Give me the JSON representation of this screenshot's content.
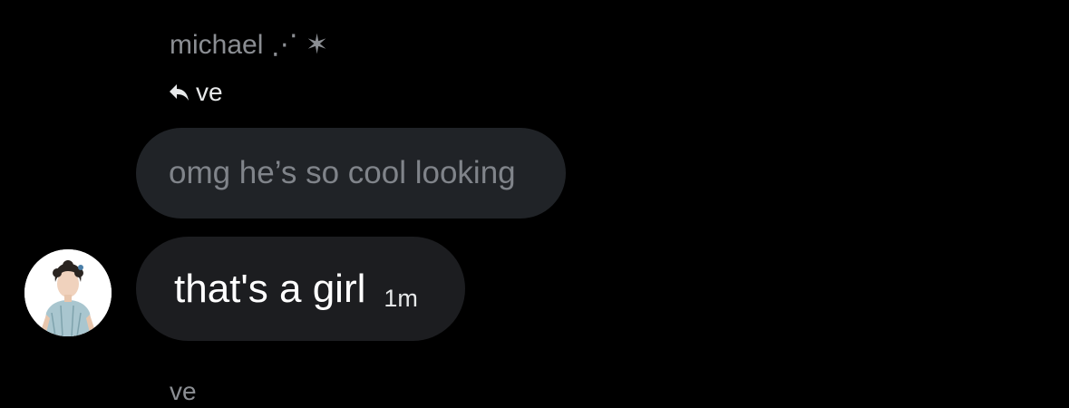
{
  "quoted_message": {
    "sender_name": "michael ⋰ ✶",
    "reply_target": "ve",
    "text": "omg he’s so cool looking"
  },
  "message": {
    "text": "that's a girl",
    "time": "1m",
    "avatar_icon": "profile-avatar"
  },
  "next_message": {
    "sender_name": "ve"
  },
  "icons": {
    "reply": "reply-arrow-icon"
  },
  "colors": {
    "background": "#000000",
    "quoted_bubble": "#202327",
    "message_bubble": "#1c1d20",
    "muted_text": "#8b8e93",
    "primary_text": "#ffffff"
  }
}
